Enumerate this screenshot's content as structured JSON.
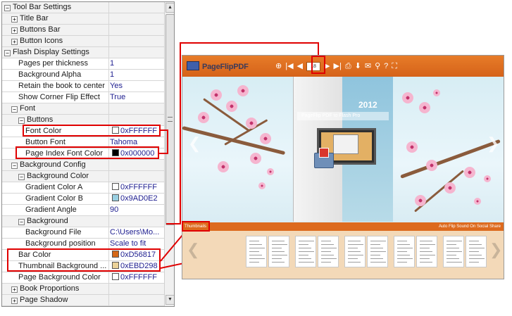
{
  "property_grid": {
    "rows": [
      {
        "type": "cat",
        "indent": 0,
        "toggle": "−",
        "name": "Tool Bar Settings",
        "value": ""
      },
      {
        "type": "cat",
        "indent": 1,
        "toggle": "+",
        "name": "Title Bar",
        "value": ""
      },
      {
        "type": "cat",
        "indent": 1,
        "toggle": "+",
        "name": "Buttons Bar",
        "value": ""
      },
      {
        "type": "cat",
        "indent": 1,
        "toggle": "+",
        "name": "Button Icons",
        "value": ""
      },
      {
        "type": "cat",
        "indent": 0,
        "toggle": "−",
        "name": "Flash Display Settings",
        "value": ""
      },
      {
        "type": "prop",
        "indent": 2,
        "name": "Pages per thickness",
        "value": "1"
      },
      {
        "type": "prop",
        "indent": 2,
        "name": "Background Alpha",
        "value": "1"
      },
      {
        "type": "prop",
        "indent": 2,
        "name": "Retain the book to center",
        "value": "Yes"
      },
      {
        "type": "prop",
        "indent": 2,
        "name": "Show Corner Flip Effect",
        "value": "True"
      },
      {
        "type": "cat",
        "indent": 1,
        "toggle": "−",
        "name": "Font",
        "value": ""
      },
      {
        "type": "cat",
        "indent": 2,
        "toggle": "−",
        "name": "Buttons",
        "value": ""
      },
      {
        "type": "prop",
        "indent": 3,
        "name": "Font Color",
        "value": "0xFFFFFF",
        "swatch": "#ffffff"
      },
      {
        "type": "prop",
        "indent": 3,
        "name": "Button Font",
        "value": "Tahoma"
      },
      {
        "type": "prop",
        "indent": 3,
        "name": "Page Index Font Color",
        "value": "0x000000",
        "swatch": "#000000"
      },
      {
        "type": "cat",
        "indent": 1,
        "toggle": "−",
        "name": "Background Config",
        "value": ""
      },
      {
        "type": "cat",
        "indent": 2,
        "toggle": "−",
        "name": "Background Color",
        "value": ""
      },
      {
        "type": "prop",
        "indent": 3,
        "name": "Gradient Color A",
        "value": "0xFFFFFF",
        "swatch": "#ffffff"
      },
      {
        "type": "prop",
        "indent": 3,
        "name": "Gradient Color B",
        "value": "0x9AD0E2",
        "swatch": "#9ad0e2"
      },
      {
        "type": "prop",
        "indent": 3,
        "name": "Gradient Angle",
        "value": "90"
      },
      {
        "type": "cat",
        "indent": 2,
        "toggle": "−",
        "name": "Background",
        "value": ""
      },
      {
        "type": "prop",
        "indent": 3,
        "name": "Background File",
        "value": "C:\\Users\\Mo..."
      },
      {
        "type": "prop",
        "indent": 3,
        "name": "Background position",
        "value": "Scale to fit"
      },
      {
        "type": "prop",
        "indent": 2,
        "name": "Bar Color",
        "value": "0xD56817",
        "swatch": "#d56817"
      },
      {
        "type": "prop",
        "indent": 2,
        "name": "Thumbnail Background ...",
        "value": "0xEBD298",
        "swatch": "#ebd298"
      },
      {
        "type": "prop",
        "indent": 2,
        "name": "Page Background Color",
        "value": "0xFFFFFF",
        "swatch": "#ffffff"
      },
      {
        "type": "cat",
        "indent": 1,
        "toggle": "+",
        "name": "Book Proportions",
        "value": ""
      },
      {
        "type": "cat",
        "indent": 1,
        "toggle": "+",
        "name": "Page Shadow",
        "value": ""
      }
    ]
  },
  "preview": {
    "logo_text": "PageFlipPDF",
    "page_number": "18",
    "toolbar_icons": [
      "zoom-in-icon",
      "first-page-icon",
      "prev-page-icon",
      "next-page-icon",
      "last-page-icon",
      "print-icon",
      "download-icon",
      "email-icon",
      "search-icon",
      "help-icon",
      "fullscreen-icon"
    ],
    "cover_year": "2012",
    "cover_title": "PageFlip PDF to Flash Pro",
    "thumbnail_tab": "Thumbnails",
    "bottom_right": "Auto Flip   Sound On   Social Share",
    "colors": {
      "bar": "#d56817",
      "thumb_bg": "#ebd298",
      "highlight": "#e00000"
    }
  }
}
